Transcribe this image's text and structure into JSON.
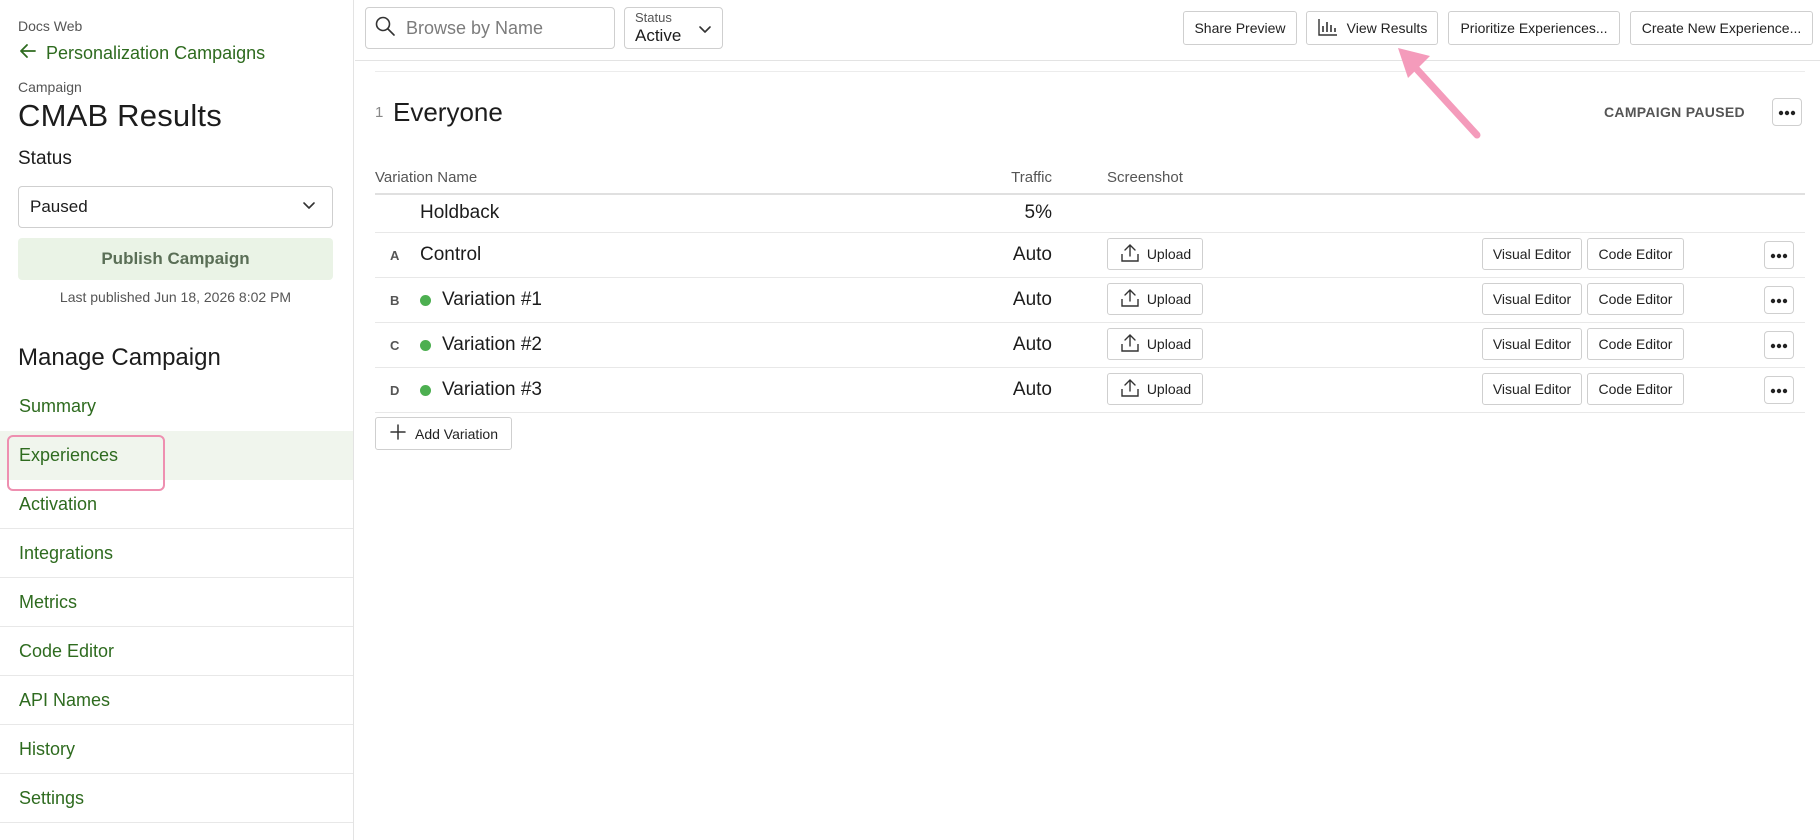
{
  "sidebar": {
    "project": "Docs Web",
    "back_link": "Personalization Campaigns",
    "campaign_label": "Campaign",
    "campaign_title": "CMAB Results",
    "status_label": "Status",
    "status_value": "Paused",
    "publish_button": "Publish Campaign",
    "last_published": "Last published Jun 18, 2026 8:02 PM",
    "manage_title": "Manage Campaign",
    "nav": [
      {
        "label": "Summary"
      },
      {
        "label": "Experiences",
        "active": true
      },
      {
        "label": "Activation"
      },
      {
        "label": "Integrations"
      },
      {
        "label": "Metrics"
      },
      {
        "label": "Code Editor"
      },
      {
        "label": "API Names"
      },
      {
        "label": "History"
      },
      {
        "label": "Settings"
      }
    ]
  },
  "toolbar": {
    "search_placeholder": "Browse by Name",
    "filter_label": "Status",
    "filter_value": "Active",
    "share_preview": "Share Preview",
    "view_results": "View Results",
    "prioritize": "Prioritize Experiences...",
    "create_new": "Create New Experience..."
  },
  "audience": {
    "number": "1",
    "name": "Everyone",
    "status": "CAMPAIGN PAUSED"
  },
  "table": {
    "headers": {
      "name": "Variation Name",
      "traffic": "Traffic",
      "screenshot": "Screenshot"
    },
    "rows": [
      {
        "letter": "",
        "name": "Holdback",
        "traffic": "5%",
        "dot": false,
        "actions": false
      },
      {
        "letter": "A",
        "name": "Control",
        "traffic": "Auto",
        "dot": false,
        "actions": true
      },
      {
        "letter": "B",
        "name": "Variation #1",
        "traffic": "Auto",
        "dot": true,
        "actions": true
      },
      {
        "letter": "C",
        "name": "Variation #2",
        "traffic": "Auto",
        "dot": true,
        "actions": true
      },
      {
        "letter": "D",
        "name": "Variation #3",
        "traffic": "Auto",
        "dot": true,
        "actions": true
      }
    ],
    "upload_label": "Upload",
    "visual_editor_label": "Visual Editor",
    "code_editor_label": "Code Editor",
    "add_variation": "Add Variation"
  },
  "colors": {
    "brand_green": "#2e6b1f",
    "status_dot": "#4caf50",
    "highlight": "#ee8fb0"
  }
}
